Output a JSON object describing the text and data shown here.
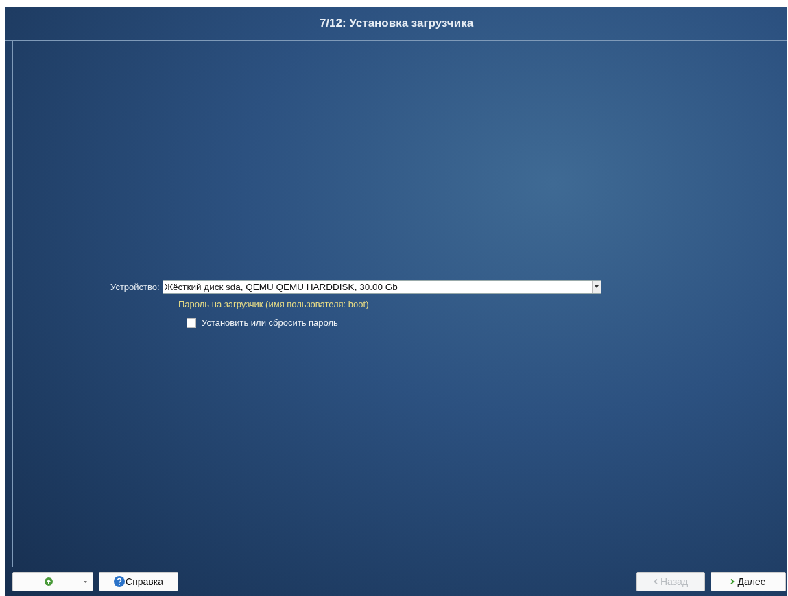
{
  "window": {
    "title": "7/12: Установка загрузчика"
  },
  "device": {
    "label": "Устройство:",
    "value": "Жёсткий диск sda, QEMU QEMU HARDDISK, 30.00 Gb"
  },
  "password": {
    "heading": "Пароль на загрузчик (имя пользователя: boot)",
    "checkbox": {
      "label": "Установить или сбросить пароль",
      "checked": false
    }
  },
  "footer": {
    "help": "Справка",
    "back": {
      "label": "Назад",
      "disabled": true
    },
    "next": {
      "label": "Далее",
      "disabled": false
    }
  }
}
